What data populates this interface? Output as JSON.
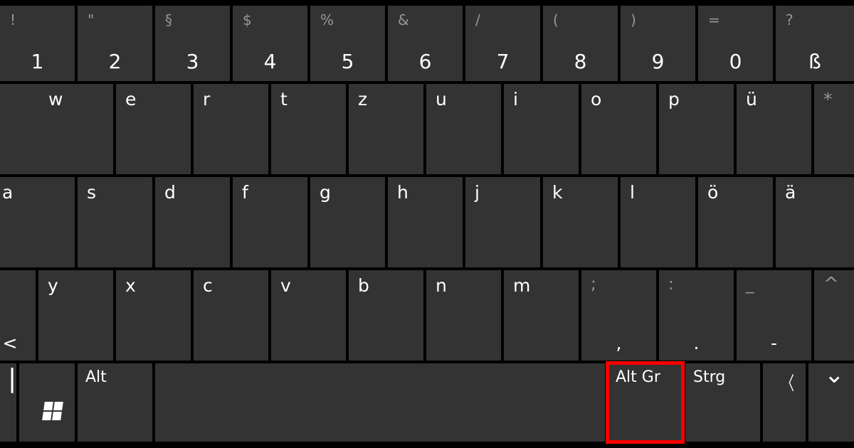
{
  "rows": {
    "num": [
      {
        "shift": "!",
        "main": "1"
      },
      {
        "shift": "\"",
        "main": "2"
      },
      {
        "shift": "§",
        "main": "3"
      },
      {
        "shift": "$",
        "main": "4"
      },
      {
        "shift": "%",
        "main": "5"
      },
      {
        "shift": "&",
        "main": "6"
      },
      {
        "shift": "/",
        "main": "7"
      },
      {
        "shift": "(",
        "main": "8"
      },
      {
        "shift": ")",
        "main": "9"
      },
      {
        "shift": "=",
        "main": "0"
      },
      {
        "shift": "?",
        "main": "ß"
      }
    ],
    "r1": [
      "w",
      "e",
      "r",
      "t",
      "z",
      "u",
      "i",
      "o",
      "p",
      "ü",
      "*"
    ],
    "r2": [
      "a",
      "s",
      "d",
      "f",
      "g",
      "h",
      "j",
      "k",
      "l",
      "ö",
      "ä"
    ],
    "r3": [
      {
        "shift": "",
        "main": "<"
      },
      {
        "shift": "",
        "main": "y"
      },
      {
        "shift": "",
        "main": "x"
      },
      {
        "shift": "",
        "main": "c"
      },
      {
        "shift": "",
        "main": "v"
      },
      {
        "shift": "",
        "main": "b"
      },
      {
        "shift": "",
        "main": "n"
      },
      {
        "shift": "",
        "main": "m"
      },
      {
        "shift": ";",
        "main": ","
      },
      {
        "shift": ":",
        "main": "."
      },
      {
        "shift": "_",
        "main": "-"
      },
      {
        "shift": "^",
        "main": ""
      }
    ],
    "r4": {
      "alt": "Alt",
      "altgr": "Alt Gr",
      "strg": "Strg"
    }
  },
  "icons": {
    "chev_left": "〈",
    "chev_down": "⌄"
  },
  "highlight": "altgr"
}
